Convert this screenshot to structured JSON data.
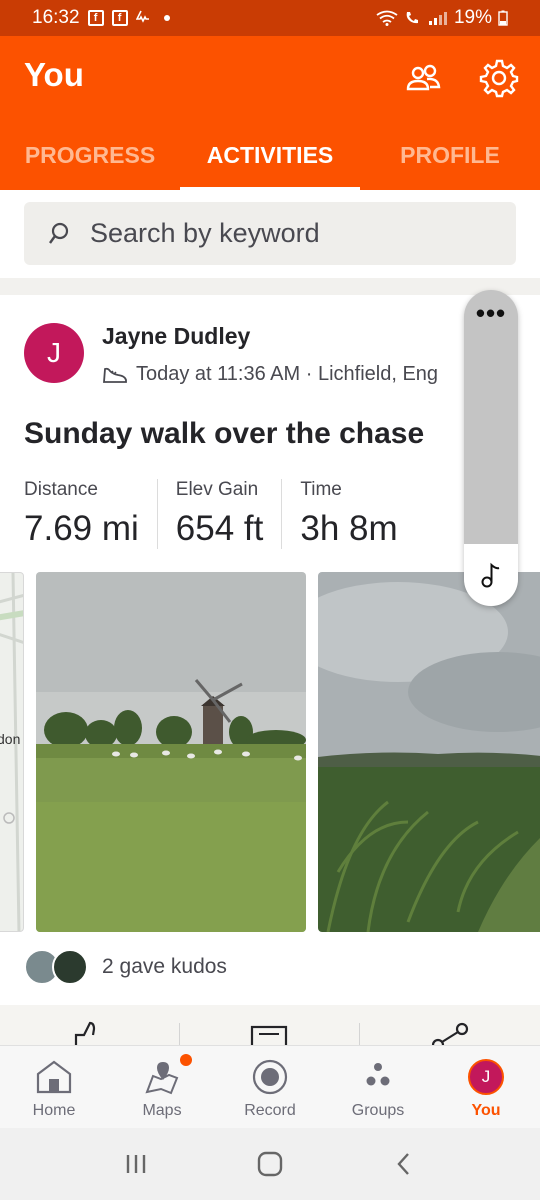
{
  "status_bar": {
    "time": "16:32",
    "battery": "19%"
  },
  "header": {
    "title": "You"
  },
  "tabs": [
    {
      "label": "PROGRESS",
      "active": false
    },
    {
      "label": "ACTIVITIES",
      "active": true
    },
    {
      "label": "PROFILE",
      "active": false
    }
  ],
  "search": {
    "placeholder": "Search by keyword"
  },
  "activity": {
    "avatar_initial": "J",
    "athlete": "Jayne Dudley",
    "meta": "Today at 11:36 AM · Lichfield, Eng",
    "title": "Sunday walk over the chase",
    "stats": [
      {
        "label": "Distance",
        "value": "7.69 mi"
      },
      {
        "label": "Elev Gain",
        "value": "654 ft"
      },
      {
        "label": "Time",
        "value": "3h 8m"
      }
    ],
    "map_fragment_text": "don",
    "kudos_text": "2 gave kudos"
  },
  "bottom_nav": [
    {
      "label": "Home",
      "icon": "home-icon",
      "active": false
    },
    {
      "label": "Maps",
      "icon": "maps-icon",
      "active": false
    },
    {
      "label": "Record",
      "icon": "record-icon",
      "active": false
    },
    {
      "label": "Groups",
      "icon": "groups-icon",
      "active": false
    },
    {
      "label": "You",
      "icon": "profile-avatar-icon",
      "active": true,
      "initial": "J"
    }
  ],
  "colors": {
    "brand": "#fc5200",
    "status_bar": "#c93c04",
    "avatar": "#c2185b"
  }
}
